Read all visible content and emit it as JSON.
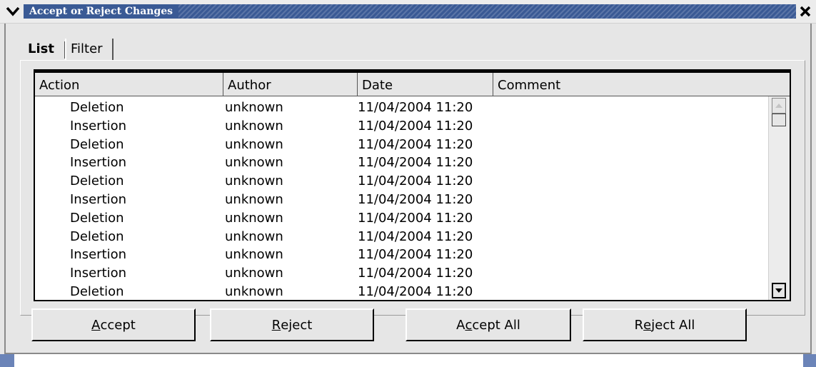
{
  "window": {
    "title": "Accept or Reject Changes"
  },
  "tabs": [
    {
      "label": "List",
      "active": true
    },
    {
      "label": "Filter",
      "active": false
    }
  ],
  "table": {
    "columns": [
      "Action",
      "Author",
      "Date",
      "Comment"
    ],
    "rows": [
      {
        "action": "Deletion",
        "author": "unknown",
        "date": "11/04/2004 11:20",
        "comment": ""
      },
      {
        "action": "Insertion",
        "author": "unknown",
        "date": "11/04/2004 11:20",
        "comment": ""
      },
      {
        "action": "Deletion",
        "author": "unknown",
        "date": "11/04/2004 11:20",
        "comment": ""
      },
      {
        "action": "Insertion",
        "author": "unknown",
        "date": "11/04/2004 11:20",
        "comment": ""
      },
      {
        "action": "Deletion",
        "author": "unknown",
        "date": "11/04/2004 11:20",
        "comment": ""
      },
      {
        "action": "Insertion",
        "author": "unknown",
        "date": "11/04/2004 11:20",
        "comment": ""
      },
      {
        "action": "Deletion",
        "author": "unknown",
        "date": "11/04/2004 11:20",
        "comment": ""
      },
      {
        "action": "Deletion",
        "author": "unknown",
        "date": "11/04/2004 11:20",
        "comment": ""
      },
      {
        "action": "Insertion",
        "author": "unknown",
        "date": "11/04/2004 11:20",
        "comment": ""
      },
      {
        "action": "Insertion",
        "author": "unknown",
        "date": "11/04/2004 11:20",
        "comment": ""
      },
      {
        "action": "Deletion",
        "author": "unknown",
        "date": "11/04/2004 11:20",
        "comment": ""
      }
    ]
  },
  "buttons": {
    "accept": {
      "mnemonic": "A",
      "rest": "ccept"
    },
    "reject": {
      "mnemonic": "R",
      "rest": "eject"
    },
    "accept_all": {
      "pre": "A",
      "mnemonic": "c",
      "rest": "cept All"
    },
    "reject_all": {
      "pre": "R",
      "mnemonic": "e",
      "rest": "ject All"
    }
  },
  "colors": {
    "titlebar_blue": "#3a5a95",
    "dialog_gray": "#e6e6e6"
  },
  "icons": {
    "menu": "chevron-down-icon",
    "close": "close-icon",
    "scroll_up": "arrow-up-icon",
    "scroll_down": "arrow-down-icon"
  }
}
